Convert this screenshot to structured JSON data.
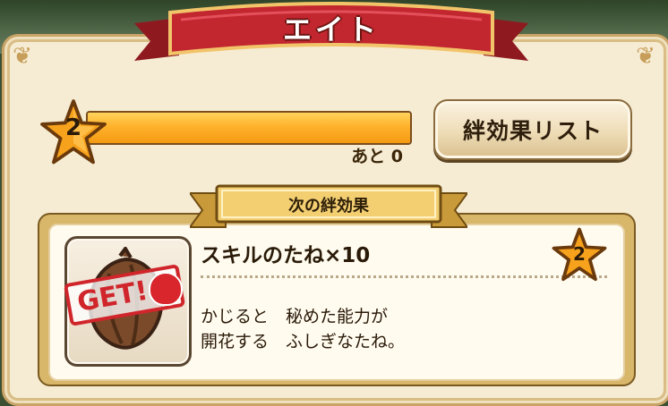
{
  "title": "エイト",
  "level": {
    "value": "2",
    "progress": 1.0,
    "remaining_label": "あと 0"
  },
  "bond_list_button": "絆効果リスト",
  "next_bonus": {
    "header": "次の絆効果",
    "item_name": "スキルのたね×10",
    "stamp": "GET!",
    "description": "かじると　秘めた能力が\n開花する　ふしぎなたね。",
    "star_level": "2"
  },
  "colors": {
    "ribbon": "#c2262f",
    "gold": "#ffb22c",
    "panel": "#f6ecd3",
    "star": "#f7a21c"
  },
  "icons": {
    "level_star": "star-icon",
    "item": "seed-nut-icon",
    "mascot": "slime-icon"
  }
}
